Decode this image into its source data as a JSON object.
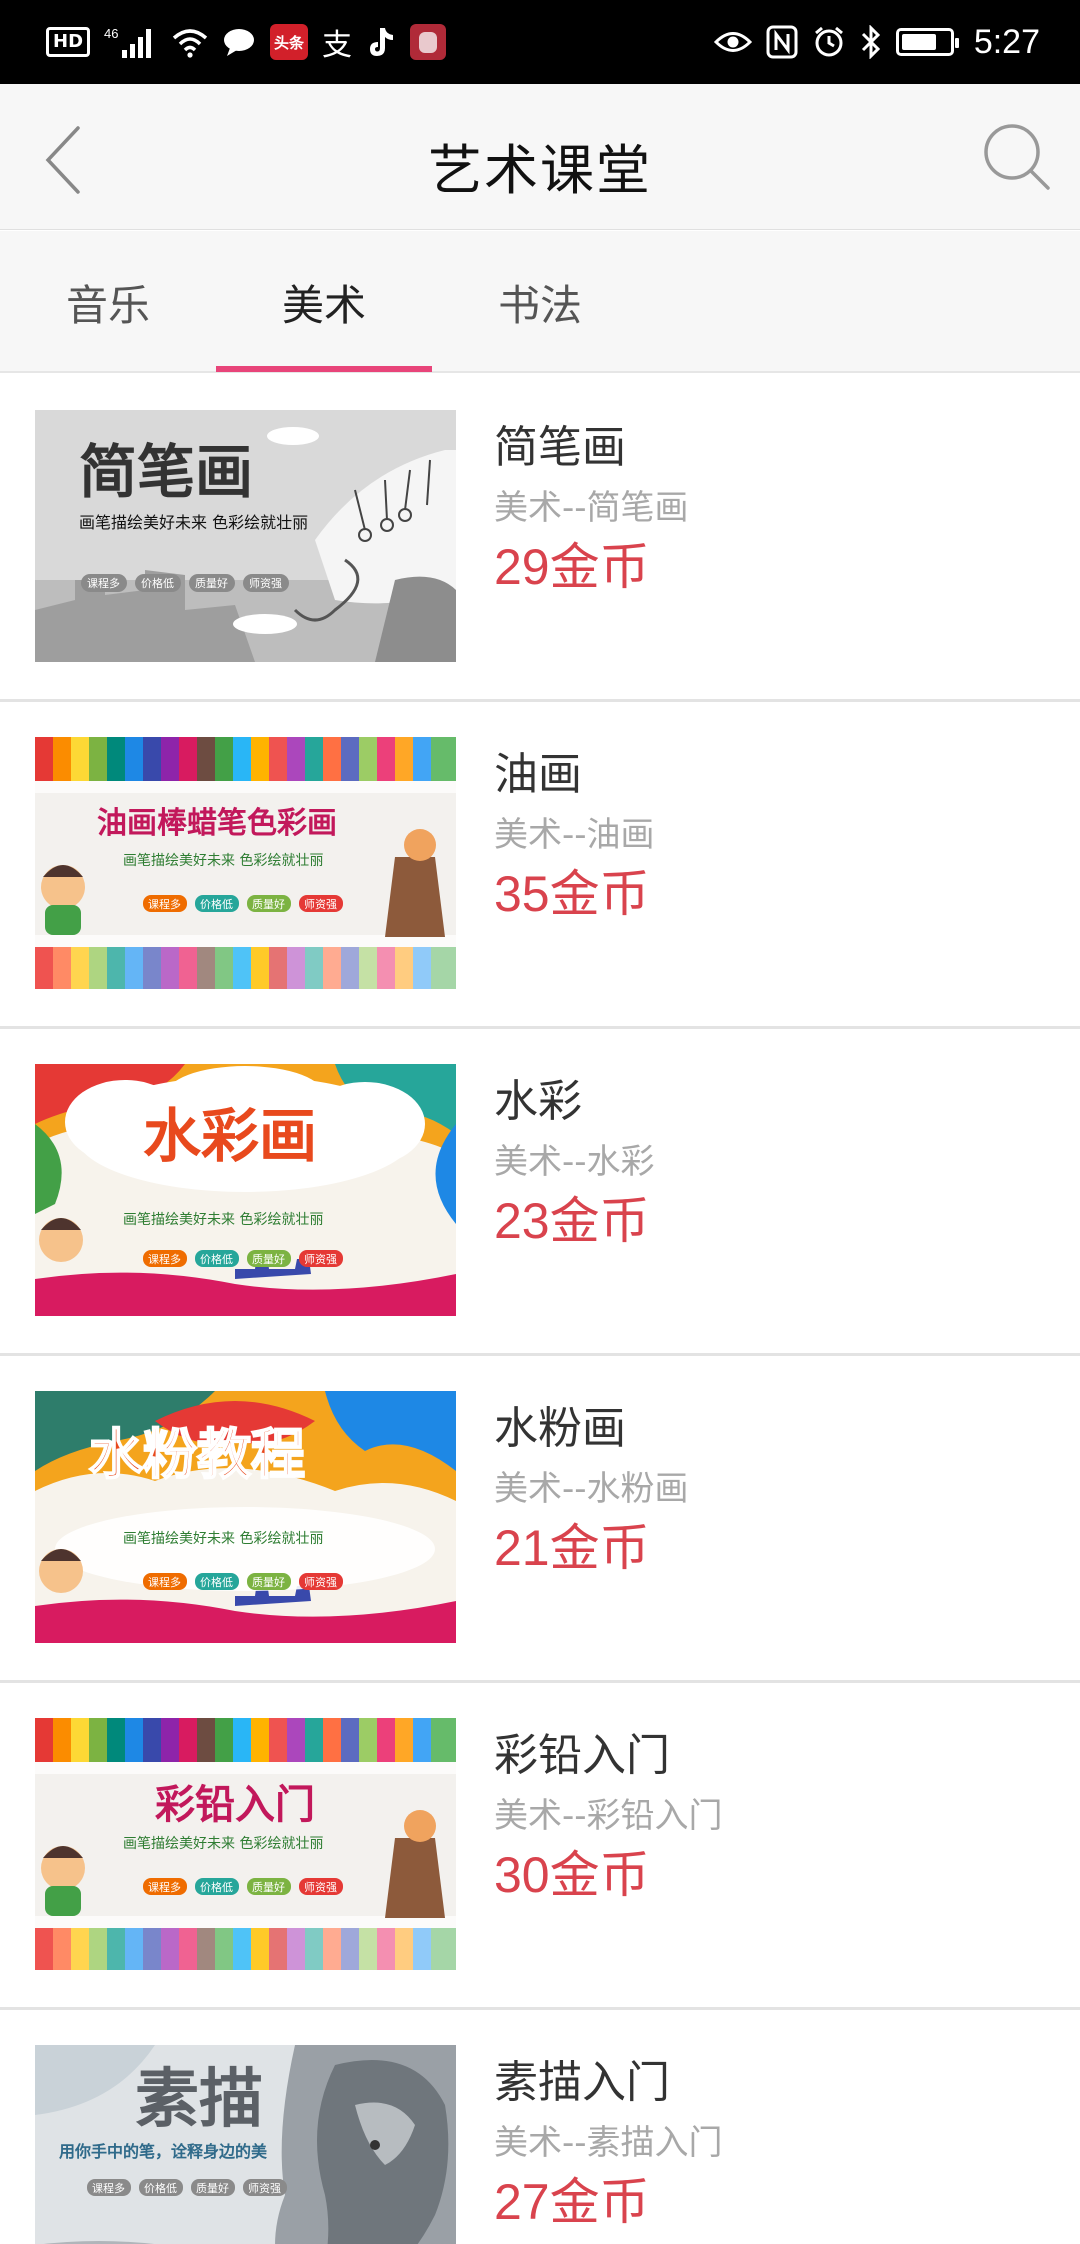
{
  "status_bar": {
    "left_icons": [
      "hd-icon",
      "signal-4g-icon",
      "wifi-icon",
      "chat-icon",
      "toutiao-icon",
      "alipay-icon",
      "tiktok-icon",
      "app-icon"
    ],
    "hd_label": "HD",
    "network_label": "46",
    "toutiao_label": "头条",
    "alipay_label": "支",
    "time": "5:27"
  },
  "header": {
    "title": "艺术课堂"
  },
  "tabs": [
    {
      "label": "音乐",
      "active": false
    },
    {
      "label": "美术",
      "active": true
    },
    {
      "label": "书法",
      "active": false
    }
  ],
  "courses": [
    {
      "name": "简笔画",
      "category": "美术--简笔画",
      "price": "29金币",
      "thumb": {
        "title": "简笔画",
        "slogan": "画笔描绘美好未来 色彩绘就壮丽",
        "tags": [
          "课程多",
          "价格低",
          "质量好",
          "师资强"
        ]
      }
    },
    {
      "name": "油画",
      "category": "美术--油画",
      "price": "35金币",
      "thumb": {
        "title": "油画棒蜡笔色彩画",
        "slogan": "画笔描绘美好未来 色彩绘就壮丽",
        "tags": [
          "课程多",
          "价格低",
          "质量好",
          "师资强"
        ]
      }
    },
    {
      "name": "水彩",
      "category": "美术--水彩",
      "price": "23金币",
      "thumb": {
        "title": "水彩画",
        "slogan": "画笔描绘美好未来 色彩绘就壮丽",
        "tags": [
          "课程多",
          "价格低",
          "质量好",
          "师资强"
        ]
      }
    },
    {
      "name": "水粉画",
      "category": "美术--水粉画",
      "price": "21金币",
      "thumb": {
        "title": "水粉教程",
        "slogan": "画笔描绘美好未来 色彩绘就壮丽",
        "tags": [
          "课程多",
          "价格低",
          "质量好",
          "师资强"
        ]
      }
    },
    {
      "name": "彩铅入门",
      "category": "美术--彩铅入门",
      "price": "30金币",
      "thumb": {
        "title": "彩铅入门",
        "slogan": "画笔描绘美好未来 色彩绘就壮丽",
        "tags": [
          "课程多",
          "价格低",
          "质量好",
          "师资强"
        ]
      }
    },
    {
      "name": "素描入门",
      "category": "美术--素描入门",
      "price": "27金币",
      "thumb": {
        "title": "素描",
        "slogan": "用你手中的笔，诠释身边的美",
        "tags": [
          "课程多",
          "价格低",
          "质量好",
          "师资强"
        ]
      }
    }
  ],
  "colors": {
    "accent": "#e8457a",
    "price": "#d9434d",
    "category_text": "#a8a8a8",
    "header_bg": "#f7f7f7"
  }
}
